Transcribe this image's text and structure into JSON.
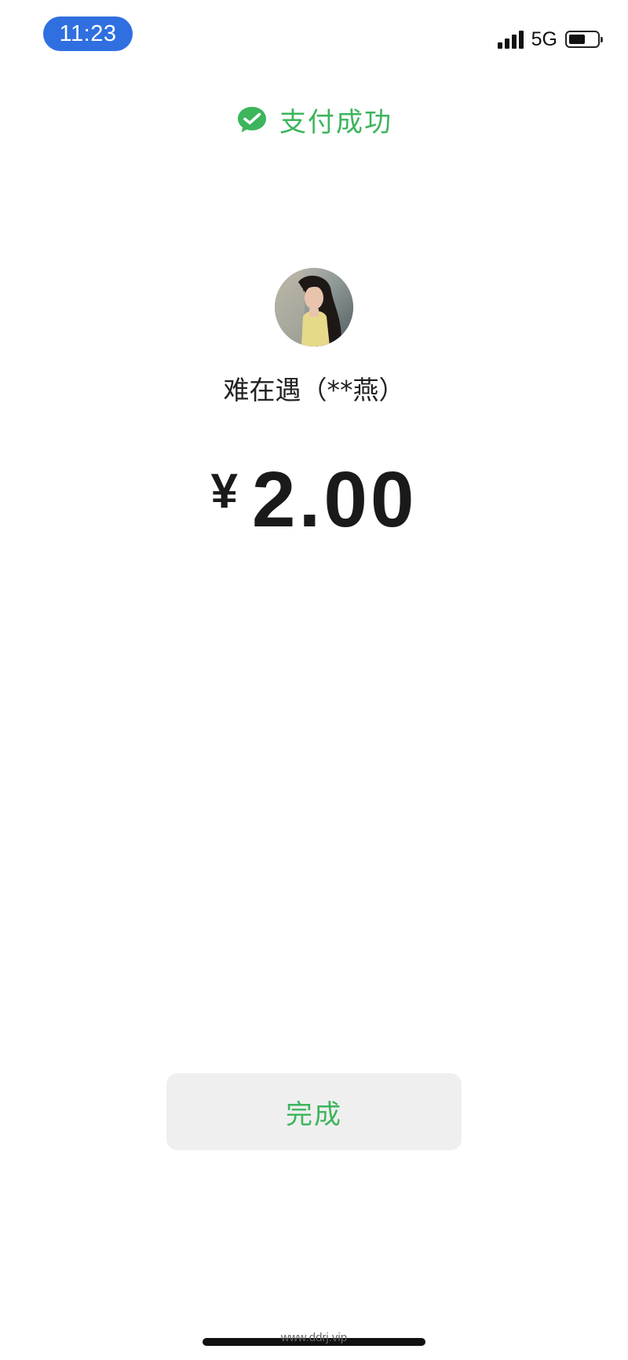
{
  "status_bar": {
    "time": "11:23",
    "network": "5G",
    "signal_icon": "signal-bars-icon",
    "battery_icon": "battery-icon",
    "battery_level": 0.6
  },
  "result": {
    "icon": "wechat-pay-icon",
    "title": "支付成功",
    "accent_color": "#3cb55c"
  },
  "payee": {
    "avatar": "avatar-photo",
    "name": "难在遇（**燕）"
  },
  "amount": {
    "currency_symbol": "¥",
    "value": "2.00"
  },
  "done_button": {
    "label": "完成"
  },
  "watermark": "www.ddrj.vip"
}
